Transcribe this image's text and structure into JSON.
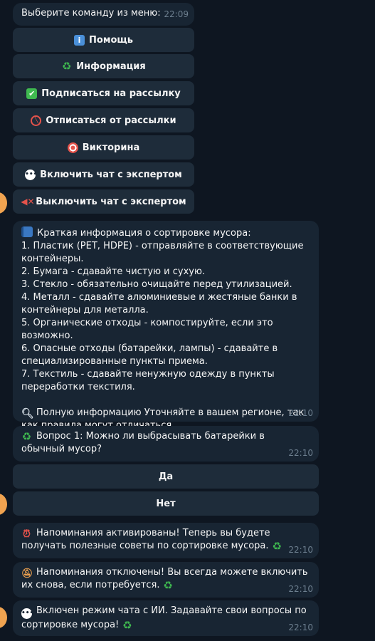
{
  "menu_message": {
    "text": "Выберите команду из меню:",
    "time": "22:09"
  },
  "menu_buttons": [
    {
      "icon": "info-icon",
      "glyph": "ℹ",
      "label": "Помощь"
    },
    {
      "icon": "recycle-icon",
      "glyph": "♻",
      "label": "Информация"
    },
    {
      "icon": "check-mark-icon",
      "glyph": "✔",
      "label": "Подписаться на рассылку"
    },
    {
      "icon": "prohibited-icon",
      "glyph": "⊘",
      "label": "Отписаться от рассылки"
    },
    {
      "icon": "dart-target-icon",
      "glyph": "◎",
      "label": "Викторина"
    },
    {
      "icon": "speech-bubble-icon",
      "glyph": "💬",
      "label": "Включить чат с экспертом"
    },
    {
      "icon": "muted-speaker-icon",
      "glyph": "🔈",
      "label": "Выключить чат с экспертом"
    }
  ],
  "info_message": {
    "icon": "blue-book-icon",
    "text": "Краткая информация о сортировке мусора:\n1. Пластик (PET, HDPE) - отправляйте в соответствующие контейнеры.\n2. Бумага - сдавайте чистую и сухую.\n3. Стекло - обязательно очищайте перед утилизацией.\n4. Металл - сдавайте алюминиевые и жестяные банки в контейнеры для металла.\n5. Органические отходы - компостируйте, если это возможно.\n6. Опасные отходы (батарейки, лампы) - сдавайте в специализированные пункты приема.\n7. Текстиль - сдавайте ненужную одежду в пункты переработки текстиля.\n\n",
    "footer_icon": "magnifier-icon",
    "footer": "Полную информацию Уточняйте в вашем регионе, так как правила могут отличаться.",
    "time": "22:10"
  },
  "quiz_message": {
    "icon": "recycle-icon",
    "text": "Вопрос 1: Можно ли выбрасывать батарейки в обычный мусор?",
    "time": "22:10"
  },
  "quiz_buttons": [
    {
      "label": "Да"
    },
    {
      "label": "Нет"
    }
  ],
  "reminder_on": {
    "icon": "alarm-clock-icon",
    "text": "Напоминания активированы! Теперь вы будете получать полезные советы по сортировке мусора.",
    "end_icon": "recycle-icon",
    "time": "22:10"
  },
  "reminder_off": {
    "icon": "bell-off-icon",
    "text": "Напоминания отключены! Вы всегда можете включить их снова, если потребуется.",
    "end_icon": "recycle-icon",
    "time": "22:10"
  },
  "ai_chat": {
    "icon": "speech-bubble-icon",
    "text": "Включен режим чата с ИИ. Задавайте свои вопросы по сортировке мусора!",
    "end_icon": "recycle-icon",
    "time": "22:10"
  },
  "colors": {
    "background": "#0e1621",
    "bubble": "#182533",
    "button": "#1e2c3a",
    "avatar": "#f0a350",
    "recycle": "#3fb950"
  }
}
